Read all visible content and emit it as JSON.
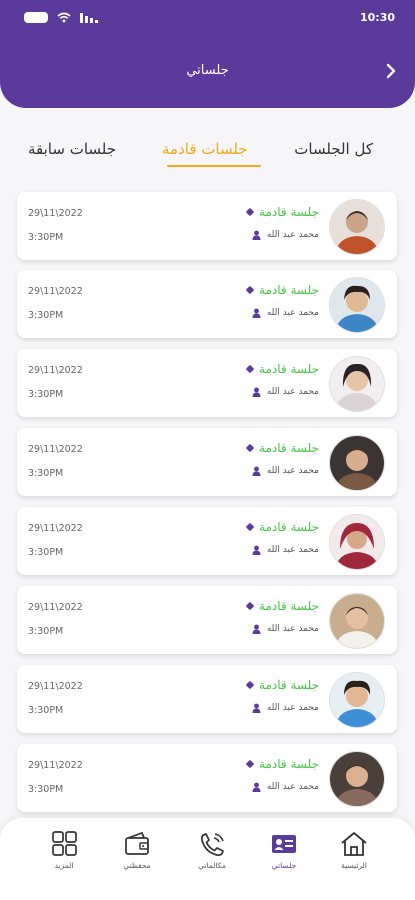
{
  "status": {
    "time": "10:30"
  },
  "header": {
    "title": "جلساتي"
  },
  "tabs": [
    {
      "label": "كل الجلسات"
    },
    {
      "label": "جلسات قادمة"
    },
    {
      "label": "جلسات سابقة"
    }
  ],
  "sessions": [
    {
      "title": "جلسة قادمة",
      "name": "محمد عبد الله",
      "date": "29\\11\\2022",
      "time": "3:30PM",
      "avatar_color": "#c0522a"
    },
    {
      "title": "جلسة قادمة",
      "name": "محمد عبد الله",
      "date": "29\\11\\2022",
      "time": "3:30PM",
      "avatar_color": "#3d86c6"
    },
    {
      "title": "جلسة قادمة",
      "name": "محمد عبد الله",
      "date": "29\\11\\2022",
      "time": "3:30PM",
      "avatar_color": "#d9d3d6"
    },
    {
      "title": "جلسة قادمة",
      "name": "محمد عبد الله",
      "date": "29\\11\\2022",
      "time": "3:30PM",
      "avatar_color": "#7b5a44"
    },
    {
      "title": "جلسة قادمة",
      "name": "محمد عبد الله",
      "date": "29\\11\\2022",
      "time": "3:30PM",
      "avatar_color": "#a0283c"
    },
    {
      "title": "جلسة قادمة",
      "name": "محمد عبد الله",
      "date": "29\\11\\2022",
      "time": "3:30PM",
      "avatar_color": "#c9ad8f"
    },
    {
      "title": "جلسة قادمة",
      "name": "محمد عبد الله",
      "date": "29\\11\\2022",
      "time": "3:30PM",
      "avatar_color": "#3f8fd6"
    },
    {
      "title": "جلسة قادمة",
      "name": "محمد عبد الله",
      "date": "29\\11\\2022",
      "time": "3:30PM",
      "avatar_color": "#8a6a5c"
    }
  ],
  "nav": [
    {
      "label": "الرئيسية",
      "icon": "home-icon"
    },
    {
      "label": "جلساتي",
      "icon": "id-card-icon"
    },
    {
      "label": "مكالماتي",
      "icon": "phone-icon"
    },
    {
      "label": "محفظتي",
      "icon": "wallet-icon"
    },
    {
      "label": "المزيد",
      "icon": "grid-icon"
    }
  ],
  "colors": {
    "primary": "#5a3a9a",
    "accent": "#f0a81a",
    "session_green": "#44c444"
  }
}
